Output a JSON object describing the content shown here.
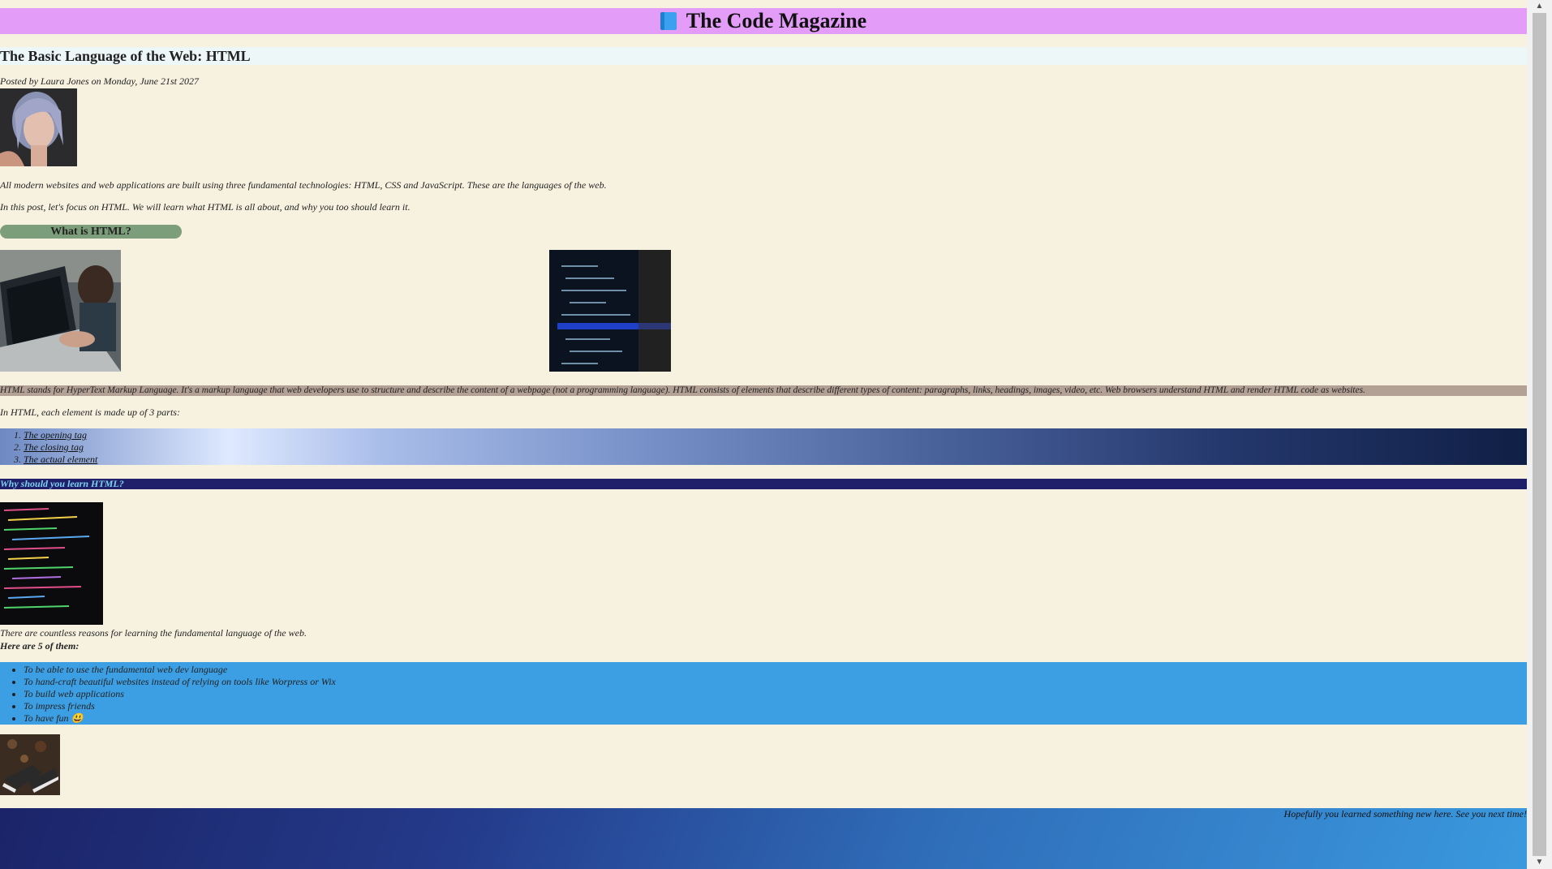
{
  "header": {
    "title": "The Code Magazine",
    "icon": "book-icon"
  },
  "post": {
    "title": "The Basic Language of the Web: HTML",
    "meta": "Posted by Laura Jones on Monday, June 21st 2027",
    "intro_1": "All modern websites and web applications are built using three fundamental technologies: HTML, CSS and JavaScript. These are the languages of the web.",
    "intro_2": "In this post, let's focus on HTML. We will learn what HTML is all about, and why you too should learn it."
  },
  "section_what": {
    "heading": "What is HTML?",
    "definition": "HTML stands for HyperText Markup Language. It's a markup language that web developers use to structure and describe the content of a webpage (not a programming language). HTML consists of elements that describe different types of content: paragraphs, links, headings, images, video, etc. Web browsers understand HTML and render HTML code as websites.",
    "parts_intro": "In HTML, each element is made up of 3 parts:",
    "parts": [
      "The opening tag",
      "The closing tag",
      "The actual element"
    ]
  },
  "section_why": {
    "heading": "Why should you learn HTML?",
    "text": "There are countless reasons for learning the fundamental language of the web.",
    "lead": "Here are 5 of them:",
    "reasons": [
      "To be able to use the fundamental web dev language",
      "To hand-craft beautiful websites instead of relying on tools like Worpress or Wix",
      "To build web applications",
      "To impress friends",
      "To have fun 😃"
    ]
  },
  "footer": {
    "text": "Hopefully you learned something new here. See you next time!"
  },
  "colors": {
    "page_bg": "#f7f2e0",
    "header_bg": "#e39cf7",
    "section_what_bg": "#7d9e7a",
    "definition_bg": "#b3a196",
    "why_heading_bg": "#20206a",
    "why_heading_text": "#7fd1f0",
    "reasons_bg": "#3d9fe3"
  }
}
